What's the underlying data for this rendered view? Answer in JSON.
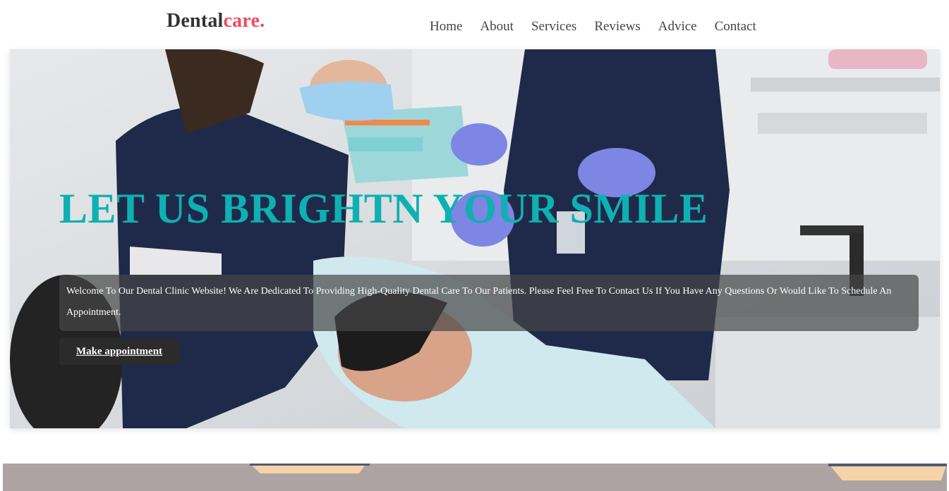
{
  "header": {
    "logo": {
      "main": "Dental",
      "accent": "care."
    },
    "nav": [
      "Home",
      "About",
      "Services",
      "Reviews",
      "Advice",
      "Contact"
    ]
  },
  "hero": {
    "title": "LET US BRIGHTN YOUR SMILE",
    "text": "Welcome To Our Dental Clinic Website! We Are Dedicated To Providing High-Quality Dental Care To Our Patients. Please Feel Free To Contact Us If You Have Any Questions Or Would Like To Schedule An Appointment.",
    "button": "Make appointment"
  },
  "colors": {
    "logo_accent": "#ef4b5f",
    "title": "#0fb0b2",
    "button_bg": "#2b2b2b"
  }
}
